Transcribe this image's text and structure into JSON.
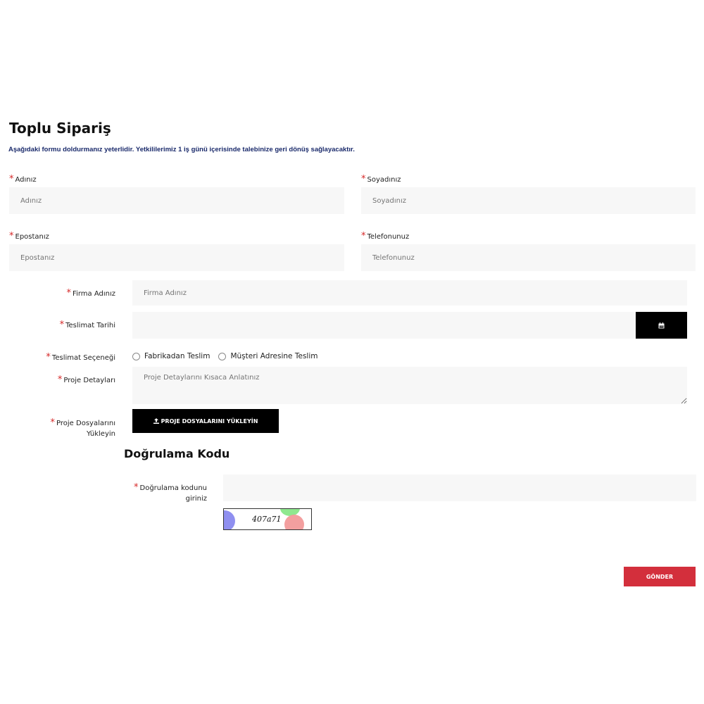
{
  "header": {
    "title": "Toplu Sipariş",
    "subtitle": "Aşağıdaki formu doldurmanız yeterlidir. Yetkililerimiz 1 iş günü içerisinde talebinize geri dönüş sağlayacaktır."
  },
  "required_mark": "*",
  "fields": {
    "first_name": {
      "label": "Adınız",
      "placeholder": "Adınız"
    },
    "last_name": {
      "label": "Soyadınız",
      "placeholder": "Soyadınız"
    },
    "email": {
      "label": "Epostanız",
      "placeholder": "Epostanız"
    },
    "phone": {
      "label": "Telefonunuz",
      "placeholder": "Telefonunuz"
    },
    "company": {
      "label": "Firma Adınız",
      "placeholder": "Firma Adınız"
    },
    "delivery_date": {
      "label": "Teslimat Tarihi",
      "placeholder": "",
      "button_icon": "calendar-icon"
    },
    "delivery_option": {
      "label": "Teslimat Seçeneği",
      "options": [
        "Fabrikadan Teslim",
        "Müşteri Adresine Teslim"
      ]
    },
    "project_details": {
      "label": "Proje Detayları",
      "placeholder": "Proje Detaylarını Kısaca Anlatınız"
    },
    "project_files": {
      "label_line1": "Proje Dosyalarını",
      "label_line2": "Yükleyin",
      "button_label": "PROJE DOSYALARINI YÜKLEYİN",
      "button_icon": "upload-icon"
    }
  },
  "verification": {
    "title": "Doğrulama Kodu",
    "label_line1": "Doğrulama kodunu",
    "label_line2": "giriniz",
    "captcha_text": "407a71"
  },
  "submit": {
    "label": "GÖNDER"
  },
  "colors": {
    "accent": "#d32f3c",
    "required": "#d62828",
    "subtitle": "#1a2a6b",
    "field_bg": "#f7f7f7",
    "dark_button": "#000000"
  }
}
